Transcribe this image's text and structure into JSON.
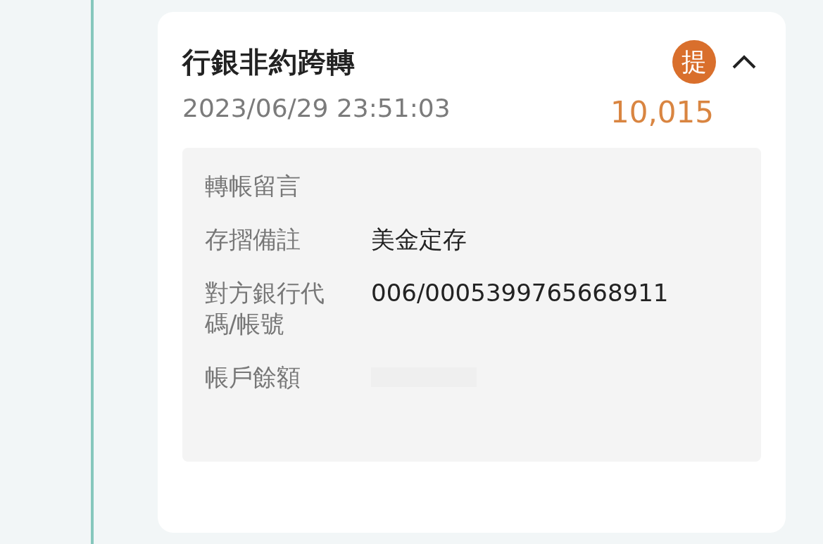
{
  "transaction": {
    "title": "行銀非約跨轉",
    "badge": "提",
    "expanded": true,
    "datetime": "2023/06/29 23:51:03",
    "amount": "10,015",
    "details": [
      {
        "label": "轉帳留言",
        "kind": "text"
      },
      {
        "label": "存摺備註",
        "value": "美金定存",
        "kind": "text"
      },
      {
        "label": "對方銀行代碼/帳號",
        "value": "006/0005399765668911",
        "kind": "text"
      },
      {
        "label": "帳戶餘額",
        "kind": "redacted"
      }
    ]
  }
}
